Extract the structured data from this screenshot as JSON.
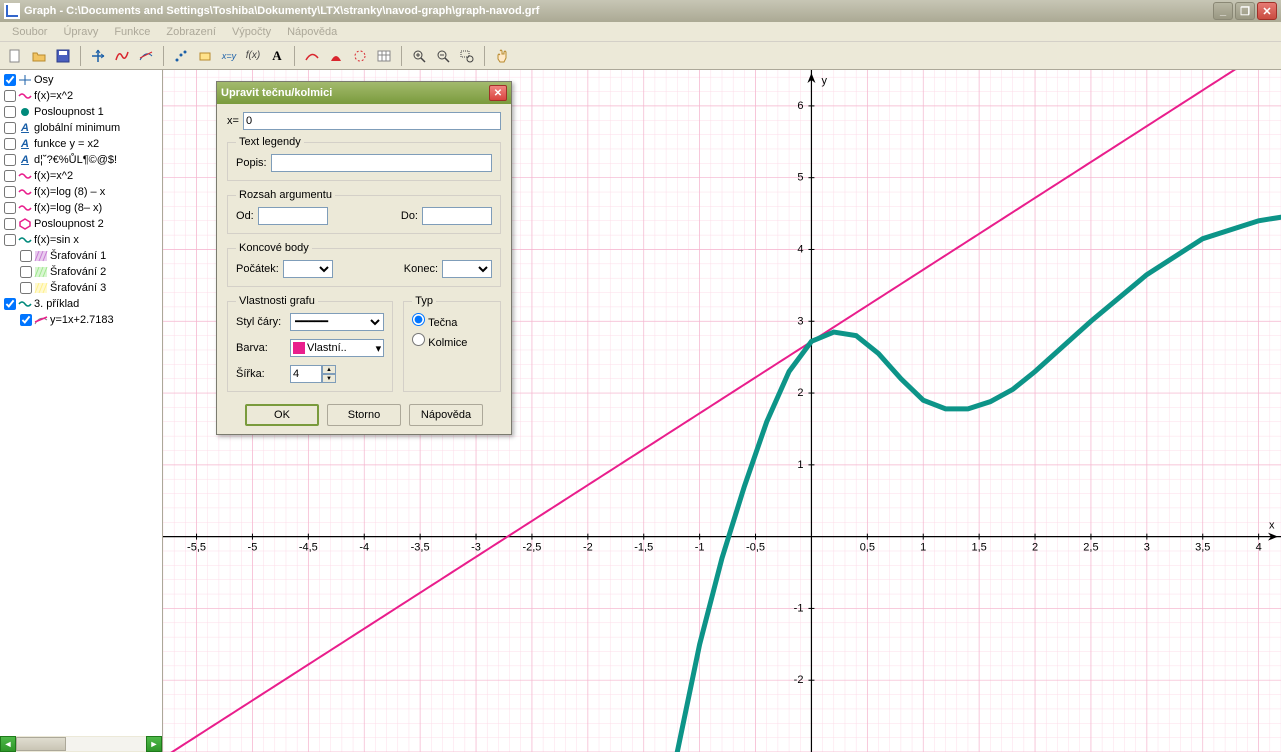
{
  "window": {
    "title": "Graph - C:\\Documents and Settings\\Toshiba\\Dokumenty\\LTX\\stranky\\navod-graph\\graph-navod.grf"
  },
  "menu": {
    "items": [
      "Soubor",
      "Úpravy",
      "Funkce",
      "Zobrazení",
      "Výpočty",
      "Nápověda"
    ]
  },
  "tree": {
    "items": [
      {
        "checked": true,
        "color": "#000",
        "label": "Osy",
        "icon": "axes"
      },
      {
        "checked": false,
        "color": "#e91e8c",
        "label": "f(x)=x^2",
        "icon": "wave"
      },
      {
        "checked": false,
        "color": "#00897b",
        "label": "Posloupnost 1",
        "icon": "dot"
      },
      {
        "checked": false,
        "color": "#1a5fa8",
        "label": "globální minimum",
        "icon": "A"
      },
      {
        "checked": false,
        "color": "#1a5fa8",
        "label": "funkce y = x2",
        "icon": "A"
      },
      {
        "checked": false,
        "color": "#1a5fa8",
        "label": "d¦˘?€%ŮL¶©@$!",
        "icon": "A"
      },
      {
        "checked": false,
        "color": "#e91e8c",
        "label": "f(x)=x^2",
        "icon": "wave"
      },
      {
        "checked": false,
        "color": "#e91e8c",
        "label": "f(x)=log (8) – x",
        "icon": "wave"
      },
      {
        "checked": false,
        "color": "#e91e8c",
        "label": "f(x)=log (8– x)",
        "icon": "wave"
      },
      {
        "checked": false,
        "color": "#e91e8c",
        "label": "Posloupnost 2",
        "icon": "hex"
      },
      {
        "checked": false,
        "color": "#00897b",
        "label": "f(x)=sin x",
        "icon": "wave"
      },
      {
        "checked": false,
        "color": "#c77dd4",
        "label": "Šrafování 1",
        "icon": "hatch",
        "indent": 1
      },
      {
        "checked": false,
        "color": "#9fe88e",
        "label": "Šrafování 2",
        "icon": "hatch",
        "indent": 1
      },
      {
        "checked": false,
        "color": "#fef08a",
        "label": "Šrafování 3",
        "icon": "hatch",
        "indent": 1
      },
      {
        "checked": true,
        "color": "#00897b",
        "label": "3. příklad",
        "icon": "wave"
      },
      {
        "checked": true,
        "color": "#e91e8c",
        "label": "y=1x+2.7183",
        "icon": "tangent",
        "indent": 1
      }
    ]
  },
  "dialog": {
    "title": "Upravit tečnu/kolmici",
    "x_label": "x=",
    "x_value": "0",
    "legend_group": "Text legendy",
    "legend_label": "Popis:",
    "legend_value": "",
    "range_group": "Rozsah argumentu",
    "range_from": "Od:",
    "range_from_value": "",
    "range_to": "Do:",
    "range_to_value": "",
    "endpoints_group": "Koncové body",
    "endpoint_start": "Počátek:",
    "endpoint_end": "Konec:",
    "props_group": "Vlastnosti grafu",
    "style_label": "Styl čáry:",
    "color_label": "Barva:",
    "color_value": "Vlastní..",
    "width_label": "Šířka:",
    "width_value": "4",
    "type_group": "Typ",
    "type_tangent": "Tečna",
    "type_normal": "Kolmice",
    "btn_ok": "OK",
    "btn_cancel": "Storno",
    "btn_help": "Nápověda"
  },
  "chart_data": {
    "type": "line",
    "xlabel": "x",
    "ylabel": "y",
    "xlim": [
      -5.8,
      4.2
    ],
    "ylim": [
      -3.0,
      6.5
    ],
    "x_ticks": [
      -5.5,
      -5,
      -4.5,
      -4,
      -3.5,
      -3,
      -2.5,
      -2,
      -1.5,
      -1,
      -0.5,
      0.5,
      1,
      1.5,
      2,
      2.5,
      3,
      3.5,
      4
    ],
    "y_ticks": [
      -2,
      -1,
      1,
      2,
      3,
      4,
      5,
      6
    ],
    "series": [
      {
        "name": "y=1x+2.7183",
        "color": "#e91e8c",
        "type": "line",
        "equation": "y = x + 2.7183"
      },
      {
        "name": "3. příklad",
        "color": "#0d9488",
        "type": "curve",
        "width": 4
      }
    ]
  }
}
